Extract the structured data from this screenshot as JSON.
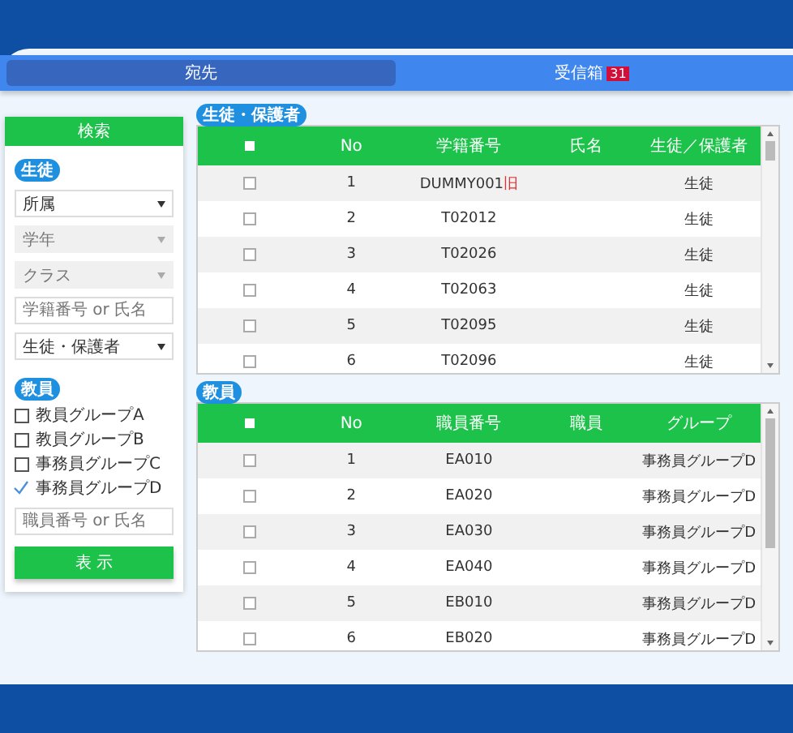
{
  "tabs": [
    {
      "label": "宛先",
      "selected": true
    },
    {
      "label": "受信箱",
      "badge": "31",
      "selected": false
    }
  ],
  "sidebar": {
    "header": "検索",
    "student_section": {
      "label": "生徒",
      "fields": [
        {
          "kind": "select",
          "value": "所属",
          "disabled": false
        },
        {
          "kind": "select",
          "value": "学年",
          "disabled": true
        },
        {
          "kind": "select",
          "value": "クラス",
          "disabled": true
        },
        {
          "kind": "input",
          "placeholder": "学籍番号 or 氏名"
        },
        {
          "kind": "select",
          "value": "生徒・保護者",
          "disabled": false
        }
      ]
    },
    "staff_section": {
      "label": "教員",
      "groups": [
        {
          "label": "教員グループA",
          "checked": false
        },
        {
          "label": "教員グループB",
          "checked": false
        },
        {
          "label": "事務員グループC",
          "checked": false
        },
        {
          "label": "事務員グループD",
          "checked": true
        }
      ],
      "search": {
        "placeholder": "職員番号 or 氏名"
      }
    },
    "button": "表 示"
  },
  "tables": [
    {
      "title": "生徒・保護者",
      "select_all": false,
      "columns": [
        "No",
        "学籍番号",
        "氏名",
        "生徒／保護者"
      ],
      "rows": [
        {
          "checked": false,
          "cells": [
            "1",
            "DUMMY001",
            "",
            "生徒"
          ],
          "flag": "旧"
        },
        {
          "checked": false,
          "cells": [
            "2",
            "T02012",
            "",
            "生徒"
          ]
        },
        {
          "checked": false,
          "cells": [
            "3",
            "T02026",
            "",
            "生徒"
          ]
        },
        {
          "checked": false,
          "cells": [
            "4",
            "T02063",
            "",
            "生徒"
          ]
        },
        {
          "checked": false,
          "cells": [
            "5",
            "T02095",
            "",
            "生徒"
          ]
        },
        {
          "checked": false,
          "cells": [
            "6",
            "T02096",
            "",
            "生徒"
          ]
        }
      ]
    },
    {
      "title": "教員",
      "select_all": false,
      "columns": [
        "No",
        "職員番号",
        "職員",
        "グループ"
      ],
      "rows": [
        {
          "checked": false,
          "cells": [
            "1",
            "EA010",
            "",
            "事務員グループD"
          ]
        },
        {
          "checked": false,
          "cells": [
            "2",
            "EA020",
            "",
            "事務員グループD"
          ]
        },
        {
          "checked": false,
          "cells": [
            "3",
            "EA030",
            "",
            "事務員グループD"
          ]
        },
        {
          "checked": false,
          "cells": [
            "4",
            "EA040",
            "",
            "事務員グループD"
          ]
        },
        {
          "checked": false,
          "cells": [
            "5",
            "EB010",
            "",
            "事務員グループD"
          ]
        },
        {
          "checked": false,
          "cells": [
            "6",
            "EB020",
            "",
            "事務員グループD"
          ]
        }
      ]
    }
  ]
}
